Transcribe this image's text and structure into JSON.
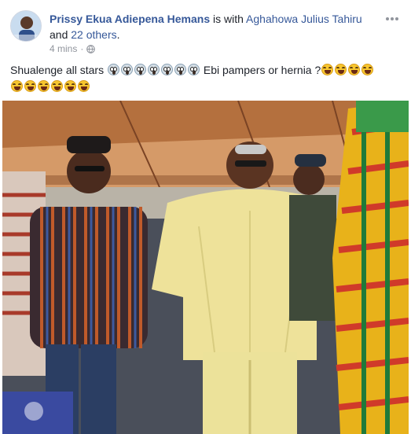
{
  "post": {
    "author": "Prissy Ekua Adiepena Hemans",
    "with_text": " is with ",
    "tagged_person": "Aghahowa Julius Tahiru",
    "and_text": " and ",
    "others": "22 others",
    "period": ".",
    "timestamp": "4 mins",
    "privacy_separator": "·",
    "privacy_icon": "globe-icon",
    "text_part1": "Shualenge all stars",
    "text_part2": "Ebi pampers or hernia ?",
    "scream_emoji_count": 7,
    "laugh_emoji_count_line1": 4,
    "laugh_emoji_count_line2": 6
  },
  "colors": {
    "link": "#365899",
    "meta": "#90949c",
    "text": "#1d2129"
  }
}
